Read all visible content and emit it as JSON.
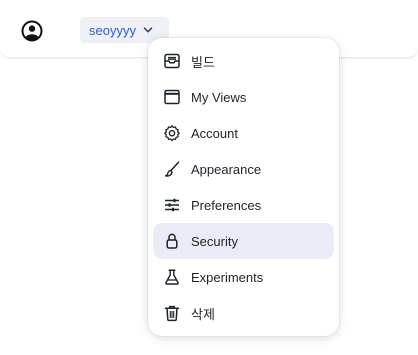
{
  "header": {
    "avatar_icon": "user-circle-icon",
    "username": "seoyyyy",
    "chevron_icon": "chevron-down-icon"
  },
  "menu": {
    "items": [
      {
        "label": "빌드",
        "icon": "inbox-tray-icon",
        "active": false
      },
      {
        "label": "My Views",
        "icon": "window-icon",
        "active": false
      },
      {
        "label": "Account",
        "icon": "gear-icon",
        "active": false
      },
      {
        "label": "Appearance",
        "icon": "paintbrush-icon",
        "active": false
      },
      {
        "label": "Preferences",
        "icon": "sliders-icon",
        "active": false
      },
      {
        "label": "Security",
        "icon": "lock-icon",
        "active": true
      },
      {
        "label": "Experiments",
        "icon": "flask-icon",
        "active": false
      },
      {
        "label": "삭제",
        "icon": "trash-icon",
        "active": false
      }
    ]
  },
  "colors": {
    "accent_text": "#2a62c9",
    "chip_bg": "#eef0f6",
    "active_item_bg": "#e9ecf5"
  }
}
